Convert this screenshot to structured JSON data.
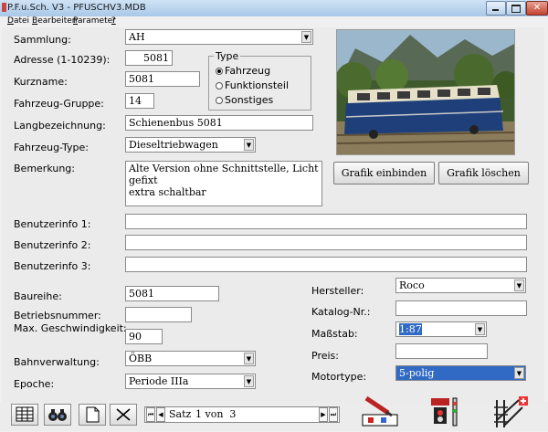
{
  "window": {
    "title": "P.F.u.Sch. V3 - PFUSCHV3.MDB"
  },
  "menu": [
    {
      "label": "Datei",
      "u": "D",
      "rest": "atei"
    },
    {
      "label": "Bearbeiten",
      "u": "B",
      "rest": "earbeiten"
    },
    {
      "label": "Parameter",
      "u": "P",
      "rest": "arameter"
    },
    {
      "label": "?",
      "u": "?",
      "rest": ""
    }
  ],
  "form": {
    "sammlung": {
      "label": "Sammlung:",
      "value": "AH"
    },
    "adresse": {
      "label": "Adresse (1-10239):",
      "value": "5081"
    },
    "kurzname": {
      "label": "Kurzname:",
      "value": "5081"
    },
    "gruppe": {
      "label": "Fahrzeug-Gruppe:",
      "value": "14"
    },
    "langbezeichnung": {
      "label": "Langbezeichnung:",
      "value": "Schienenbus 5081"
    },
    "fahrzeugtype": {
      "label": "Fahrzeug-Type:",
      "value": "Dieseltriebwagen"
    },
    "bemerkung": {
      "label": "Bemerkung:",
      "line1": "Alte Version ohne Schnittstelle, Licht gefixt",
      "line2": "extra schaltbar"
    },
    "benutzer1": {
      "label": "Benutzerinfo 1:",
      "value": ""
    },
    "benutzer2": {
      "label": "Benutzerinfo 2:",
      "value": ""
    },
    "benutzer3": {
      "label": "Benutzerinfo 3:",
      "value": ""
    },
    "baureihe": {
      "label": "Baureihe:",
      "value": "5081"
    },
    "betriebsnummer": {
      "label": "Betriebsnummer:",
      "value": ""
    },
    "geschwindigkeit": {
      "label": "Max. Geschwindigkeit:",
      "value": "90"
    },
    "bahnverwaltung": {
      "label": "Bahnverwaltung:",
      "value": "ÖBB"
    },
    "epoche": {
      "label": "Epoche:",
      "value": "Periode IIIa"
    },
    "hersteller": {
      "label": "Hersteller:",
      "value": "Roco"
    },
    "katalog": {
      "label": "Katalog-Nr.:",
      "value": ""
    },
    "massstab": {
      "label": "Maßstab:",
      "value": "1:87"
    },
    "preis": {
      "label": "Preis:",
      "value": ""
    },
    "motortype": {
      "label": "Motortype:",
      "value": "5-polig"
    }
  },
  "type_group": {
    "label": "Type",
    "options": [
      "Fahrzeug",
      "Funktionsteil",
      "Sonstiges"
    ],
    "selected": "Fahrzeug"
  },
  "buttons": {
    "grafik_einbinden": "Grafik einbinden",
    "grafik_loeschen": "Grafik löschen"
  },
  "navigator": {
    "prefix": "Satz",
    "record": "1 von  3"
  },
  "icons": [
    "table-icon",
    "binoculars-icon",
    "new-document-icon",
    "delete-x-icon",
    "loco-edit-icon",
    "signal-icon",
    "track-switch-icon"
  ]
}
